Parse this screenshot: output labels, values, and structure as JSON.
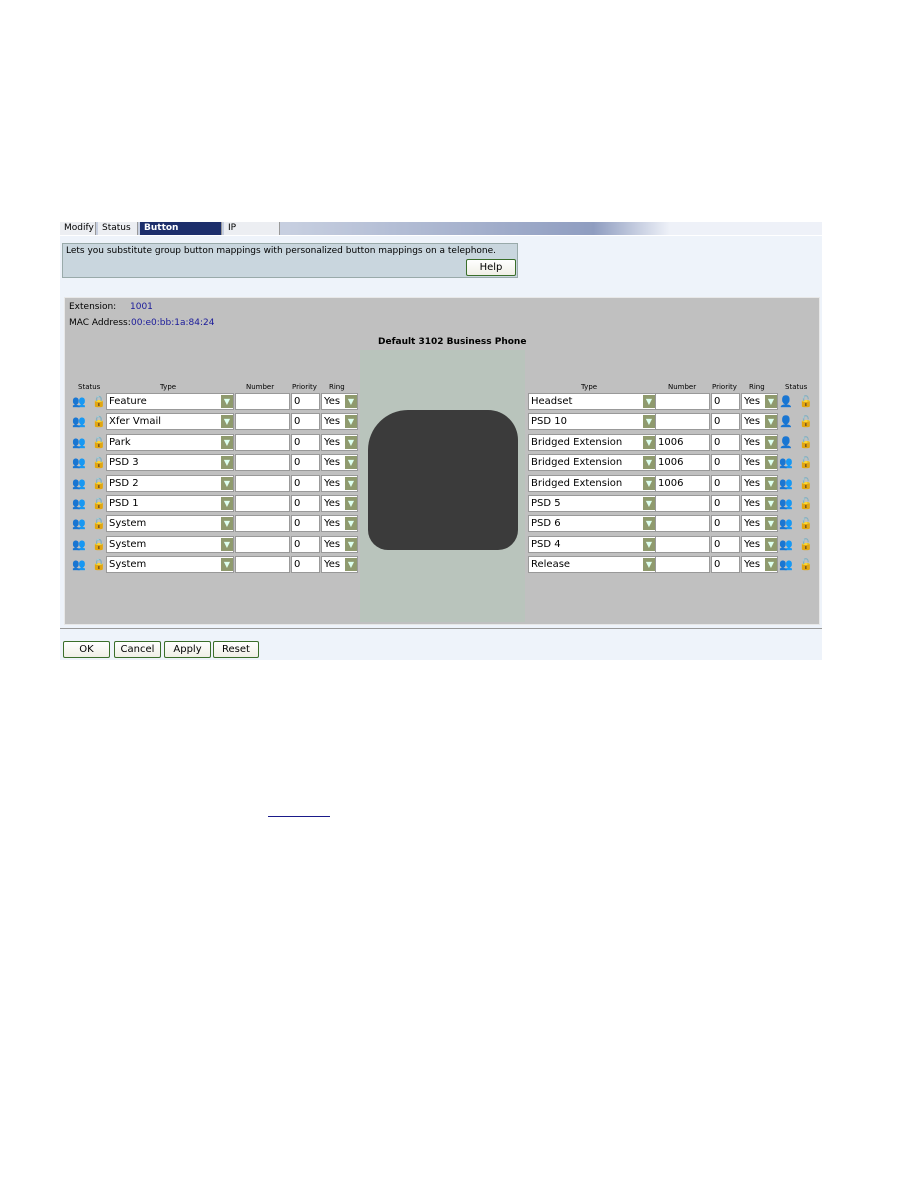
{
  "tabs": [
    {
      "label": "Modify",
      "active": false
    },
    {
      "label": "Status",
      "active": false
    },
    {
      "label": "Button Mapping",
      "active": true
    },
    {
      "label": "IP Settings",
      "active": false
    }
  ],
  "description": "Lets you substitute group button mappings with personalized button mappings on a telephone.",
  "help_label": "Help",
  "extension_label": "Extension:",
  "extension": "1001",
  "mac_label": "MAC Address:",
  "mac": "00:e0:bb:1a:84:24",
  "phone_title": "Default 3102 Business Phone",
  "headers": {
    "status": "Status",
    "type": "Type",
    "number": "Number",
    "priority": "Priority",
    "ring": "Ring"
  },
  "left_rows": [
    {
      "type": "Feature",
      "number": "",
      "priority": "0",
      "ring": "Yes",
      "status": "group",
      "lock": "locked"
    },
    {
      "type": "Xfer Vmail",
      "number": "",
      "priority": "0",
      "ring": "Yes",
      "status": "group",
      "lock": "locked"
    },
    {
      "type": "Park",
      "number": "",
      "priority": "0",
      "ring": "Yes",
      "status": "group",
      "lock": "locked"
    },
    {
      "type": "PSD 3",
      "number": "",
      "priority": "0",
      "ring": "Yes",
      "status": "group",
      "lock": "locked"
    },
    {
      "type": "PSD 2",
      "number": "",
      "priority": "0",
      "ring": "Yes",
      "status": "group",
      "lock": "locked"
    },
    {
      "type": "PSD 1",
      "number": "",
      "priority": "0",
      "ring": "Yes",
      "status": "group",
      "lock": "locked"
    },
    {
      "type": "System",
      "number": "",
      "priority": "0",
      "ring": "Yes",
      "status": "group",
      "lock": "locked"
    },
    {
      "type": "System",
      "number": "",
      "priority": "0",
      "ring": "Yes",
      "status": "group",
      "lock": "locked"
    },
    {
      "type": "System",
      "number": "",
      "priority": "0",
      "ring": "Yes",
      "status": "group",
      "lock": "locked"
    }
  ],
  "right_rows": [
    {
      "type": "Headset",
      "number": "",
      "priority": "0",
      "ring": "Yes",
      "status": "user",
      "lock": "unlocked"
    },
    {
      "type": "PSD 10",
      "number": "",
      "priority": "0",
      "ring": "Yes",
      "status": "user",
      "lock": "unlocked"
    },
    {
      "type": "Bridged Extension",
      "number": "1006",
      "priority": "0",
      "ring": "Yes",
      "status": "user",
      "lock": "unlocked"
    },
    {
      "type": "Bridged Extension",
      "number": "1006",
      "priority": "0",
      "ring": "Yes",
      "status": "group",
      "lock": "unlocked"
    },
    {
      "type": "Bridged Extension",
      "number": "1006",
      "priority": "0",
      "ring": "Yes",
      "status": "group",
      "lock": "unlocked"
    },
    {
      "type": "PSD 5",
      "number": "",
      "priority": "0",
      "ring": "Yes",
      "status": "group",
      "lock": "unlocked"
    },
    {
      "type": "PSD 6",
      "number": "",
      "priority": "0",
      "ring": "Yes",
      "status": "group",
      "lock": "unlocked"
    },
    {
      "type": "PSD 4",
      "number": "",
      "priority": "0",
      "ring": "Yes",
      "status": "group",
      "lock": "unlocked"
    },
    {
      "type": "Release",
      "number": "",
      "priority": "0",
      "ring": "Yes",
      "status": "group",
      "lock": "unlocked"
    }
  ],
  "buttons": {
    "ok": "OK",
    "cancel": "Cancel",
    "apply": "Apply",
    "reset": "Reset"
  }
}
